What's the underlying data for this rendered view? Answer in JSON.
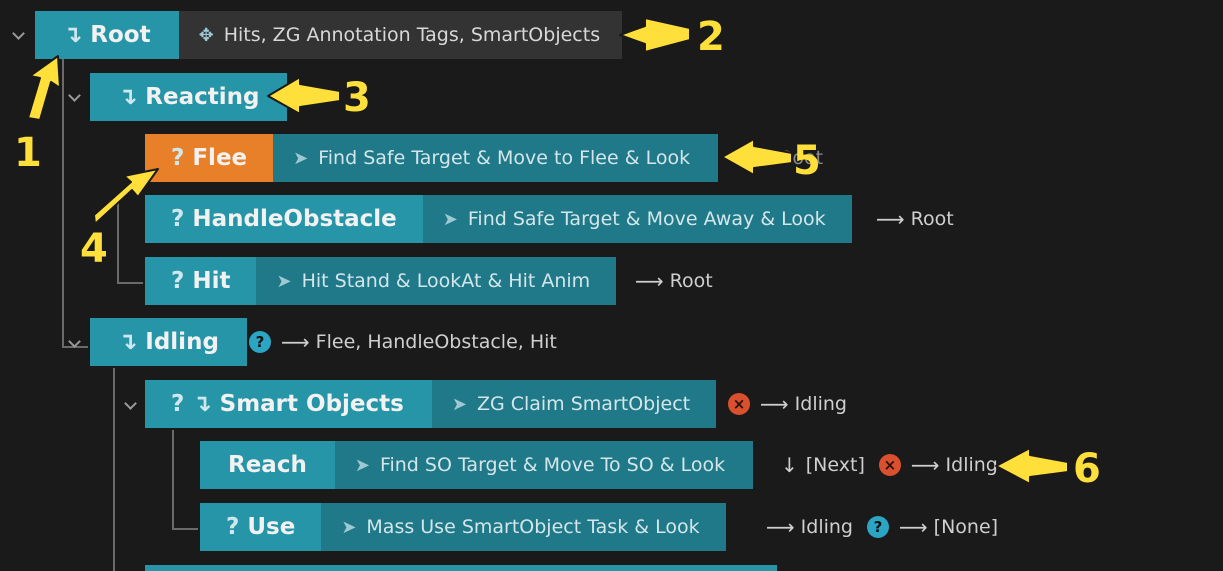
{
  "tree": {
    "root": {
      "name": "Root",
      "prefix": "↴",
      "task": "Hits, ZG Annotation Tags, SmartObjects"
    },
    "reacting": {
      "name": "Reacting",
      "prefix": "↴"
    },
    "flee": {
      "name": "Flee",
      "prefix": "?",
      "task": "Find Safe Target & Move to Flee & Look",
      "trail": "Root"
    },
    "handle": {
      "name": "HandleObstacle",
      "prefix": "?",
      "task": "Find Safe Target & Move Away & Look",
      "trail": "Root"
    },
    "hit": {
      "name": "Hit",
      "prefix": "?",
      "task": "Hit Stand & LookAt & Hit Anim",
      "trail": "Root"
    },
    "idling": {
      "name": "Idling",
      "prefix": "↴",
      "trail": "Flee, HandleObstacle, Hit"
    },
    "smart": {
      "name": "Smart Objects",
      "prefix": "? ↴",
      "task": "ZG Claim SmartObject",
      "trail": "Idling"
    },
    "reach": {
      "name": "Reach",
      "task": "Find SO Target & Move To SO & Look",
      "next": "[Next]",
      "trail": "Idling"
    },
    "use": {
      "name": "Use",
      "prefix": "?",
      "task": "Mass Use SmartObject Task & Look",
      "trail1": "Idling",
      "trail2": "[None]"
    }
  },
  "icons": {
    "tag": "move-cross-icon",
    "task": "paper-plane-icon",
    "help": "question-circle-icon",
    "fail": "x-circle-icon",
    "transition": "arrow-right-icon"
  },
  "annotations": [
    "1",
    "2",
    "3",
    "4",
    "5",
    "6"
  ],
  "colors": {
    "background": "#1a1a1a",
    "state": "#2795a8",
    "selected_state": "#e8802a",
    "task": "#1f7988",
    "annotation": "#ffe03a"
  }
}
